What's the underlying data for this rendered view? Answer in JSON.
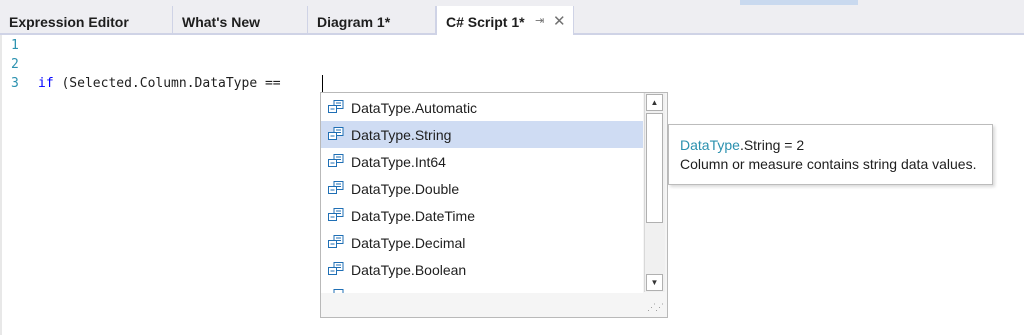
{
  "tabs": [
    {
      "label": "Expression Editor"
    },
    {
      "label": "What's New"
    },
    {
      "label": "Diagram 1*"
    },
    {
      "label": "C# Script 1*",
      "pin_glyph": "⇥",
      "close_glyph": "✕"
    }
  ],
  "editor": {
    "line_numbers": [
      "1",
      "2",
      "3"
    ],
    "line3_keyword": "if",
    "line3_rest": " (Selected.Column.DataType =="
  },
  "completion": {
    "items": [
      "DataType.Automatic",
      "DataType.String",
      "DataType.Int64",
      "DataType.Double",
      "DataType.DateTime",
      "DataType.Decimal",
      "DataType.Boolean"
    ],
    "selected_index": 1,
    "item_icon": "enum-member-icon",
    "scroll_up": "▲",
    "scroll_down": "▼",
    "resize_grip": "⋰"
  },
  "tooltip": {
    "type_name": "DataType",
    "member": ".String = 2",
    "description": "Column or measure contains string data values."
  },
  "colors": {
    "keyword": "#0000ff",
    "type": "#2b91af",
    "selection": "#cfdcf3"
  }
}
